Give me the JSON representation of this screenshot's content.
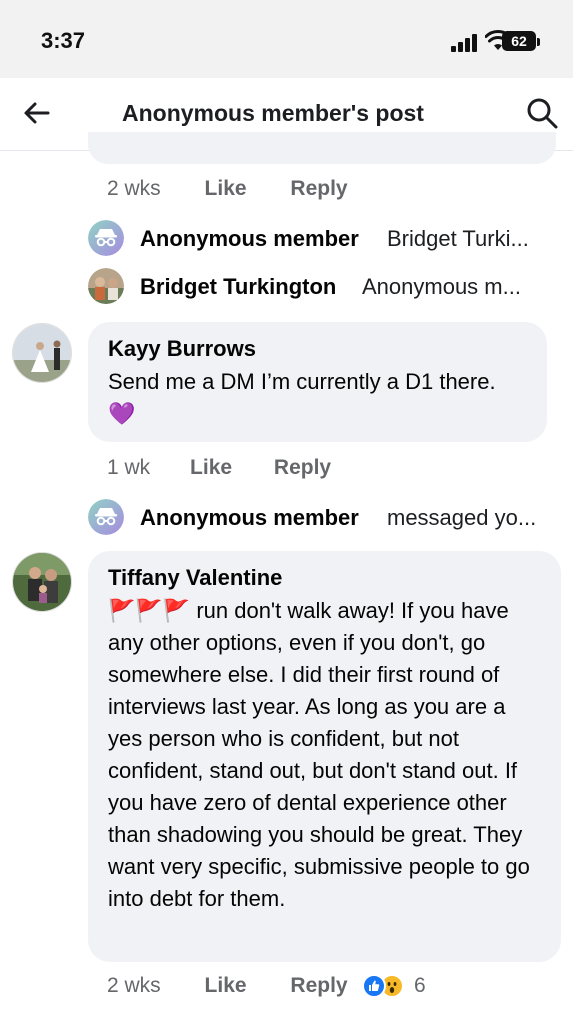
{
  "status_bar": {
    "time": "3:37",
    "battery": "62"
  },
  "header": {
    "title": "Anonymous member's post"
  },
  "comment_prev_meta": {
    "time": "2 wks",
    "like": "Like",
    "reply": "Reply"
  },
  "replies_1": [
    {
      "name": "Anonymous member",
      "snippet": "Bridget Turki..."
    },
    {
      "name": "Bridget Turkington",
      "snippet": "Anonymous m..."
    }
  ],
  "comment_kayy": {
    "name": "Kayy Burrows",
    "text": "Send me a DM I’m currently a D1 there.",
    "emoji": "💜",
    "time": "1 wk",
    "like": "Like",
    "reply": "Reply"
  },
  "replies_2": [
    {
      "name": "Anonymous member",
      "snippet": "messaged yo..."
    }
  ],
  "comment_tiffany": {
    "name": "Tiffany Valentine",
    "flags": "🚩🚩🚩",
    "text": "run don't walk away! If you have any other options, even if you don't, go somewhere else. I did their first round of interviews last year. As long as you are a yes person who is confident, but not confident, stand out, but don't stand out. If you have zero of dental experience other than shadowing you should be great. They want very specific, submissive people to go into debt for them.",
    "time": "2 wks",
    "like": "Like",
    "reply": "Reply",
    "reaction_count": "6"
  },
  "colors": {
    "bubble": "#f0f2f5",
    "meta": "#65676b",
    "like_blue": "#1877f2",
    "wow_yellow": "#f7b928"
  },
  "icons": [
    "back-arrow-icon",
    "search-icon",
    "anonymous-icon",
    "like-reaction-icon",
    "wow-reaction-icon"
  ]
}
